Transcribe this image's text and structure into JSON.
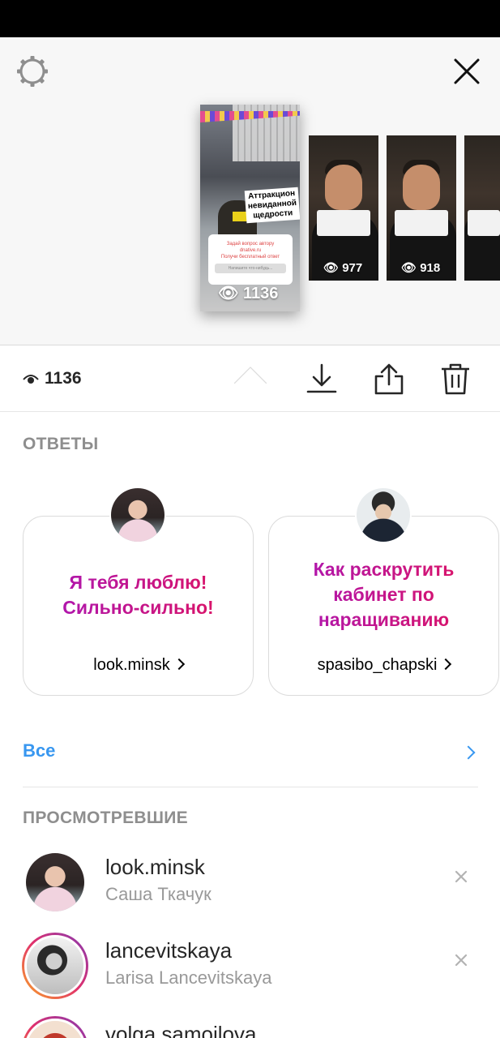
{
  "story": {
    "main_views": "1136",
    "main_caption": "Аттракцион невиданной щедрости",
    "main_card_line1": "Задай вопрос автору",
    "main_card_line2": "dnative.ru",
    "main_card_line3": "Получи бесплатный ответ",
    "main_card_input": "Напишите что-нибудь...",
    "thumb2_views": "977",
    "thumb3_views": "918"
  },
  "stats": {
    "views": "1136"
  },
  "answers": {
    "title": "ОТВЕТЫ",
    "items": [
      {
        "text": "Я тебя люблю! Сильно-сильно!",
        "user": "look.minsk"
      },
      {
        "text": "Как раскрутить кабинет по наращиванию",
        "user": "spasibo_chapski"
      }
    ],
    "all_label": "Все"
  },
  "viewers": {
    "title": "ПРОСМОТРЕВШИЕ",
    "items": [
      {
        "username": "look.minsk",
        "fullname": "Саша Ткачук"
      },
      {
        "username": "lancevitskaya",
        "fullname": "Larisa Lancevitskaya"
      },
      {
        "username": "volga.samoilova",
        "fullname": ""
      }
    ]
  },
  "colors": {
    "link_blue": "#3897f0",
    "answer_gradient_start": "#a817b9",
    "answer_gradient_end": "#e1135d",
    "muted_gray": "#8e8e8e"
  },
  "icons": [
    "settings-icon",
    "close-icon",
    "eye-icon",
    "download-icon",
    "share-icon",
    "trash-icon",
    "chevron-right-icon",
    "dismiss-icon"
  ]
}
